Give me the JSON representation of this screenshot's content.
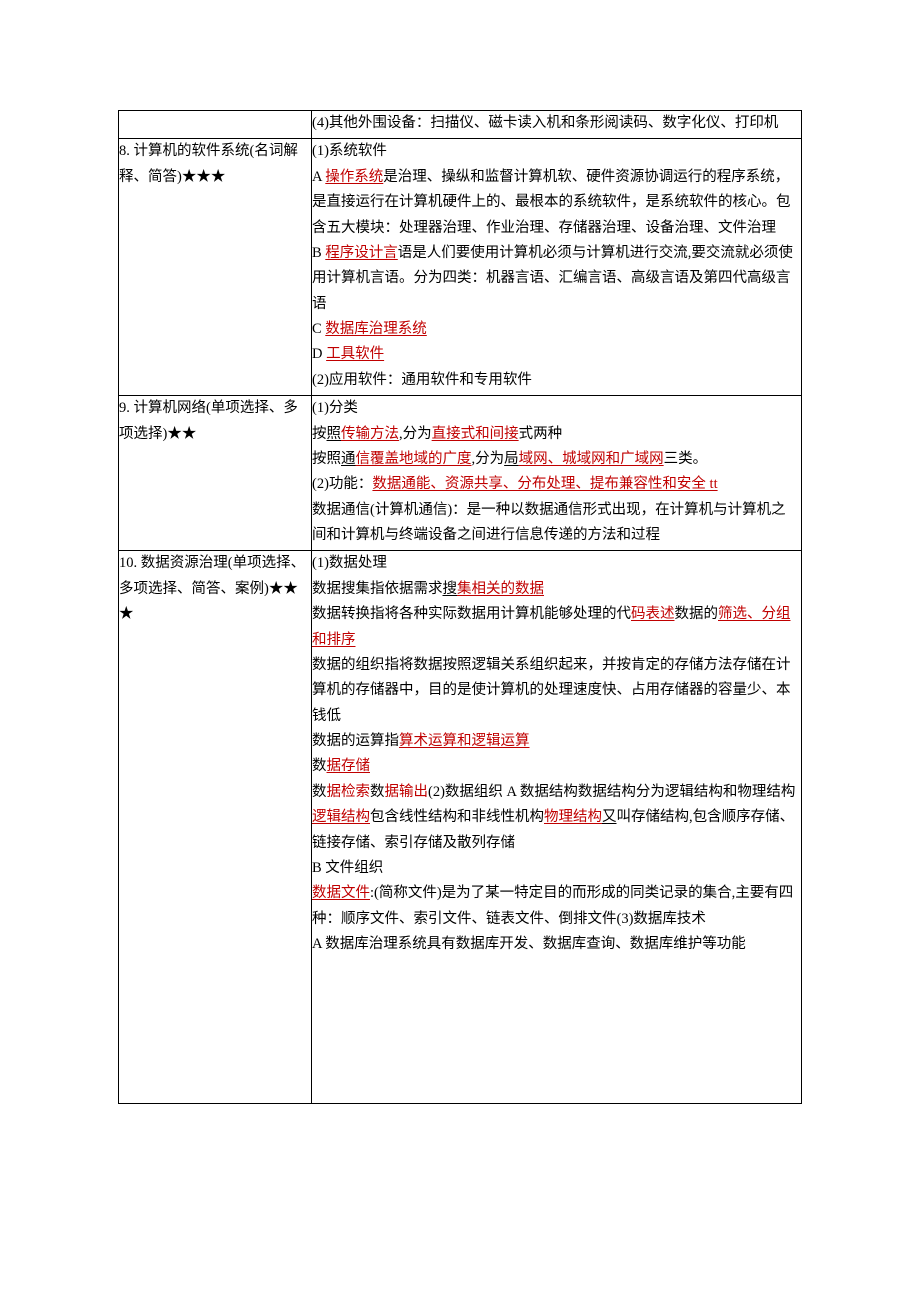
{
  "rows": [
    {
      "left": "",
      "right_parts": [
        {
          "t": "(4)其他外围设备：扫描仪、磁卡读入机和条形阅读码、数字化仪、打印机"
        }
      ]
    },
    {
      "left": "8. 计算机的软件系统(名词解释、简答)★★★",
      "right_parts": [
        {
          "t": "(1)系统软件"
        },
        {
          "br": true
        },
        {
          "t": "A "
        },
        {
          "t": "操作系统",
          "c": "red u"
        },
        {
          "t": "是治理、操纵和监督计算机软、硬件资源协调运行的程序系统，是直接运行在计算机硬件上的、最根本的系统软件，是系统软件的核心。包含五大模块：处理器治理、作业治理、存储器治理、设备治理、文件治理"
        },
        {
          "br": true
        },
        {
          "t": "B "
        },
        {
          "t": "程序设计言",
          "c": "red u"
        },
        {
          "t": "语是人们要使用计算机必须与计算机进行交流,要交流就必须使用计算机言语。分为四类：机器言语、汇编言语、高级言语及第四代高级言语"
        },
        {
          "br": true
        },
        {
          "t": "C "
        },
        {
          "t": "数据库治理系统",
          "c": "red u"
        },
        {
          "br": true
        },
        {
          "t": "D "
        },
        {
          "t": "工具软件",
          "c": "red u"
        },
        {
          "br": true
        },
        {
          "t": "(2)应用软件：通用软件和专用软件"
        }
      ]
    },
    {
      "left": "9. 计算机网络(单项选择、多项选择)★★",
      "right_parts": [
        {
          "t": "(1)分类"
        },
        {
          "br": true
        },
        {
          "t": "按"
        },
        {
          "t": "照",
          "c": "ub"
        },
        {
          "t": "传输方法",
          "c": "red u"
        },
        {
          "t": ",分为"
        },
        {
          "t": "直接式和间接",
          "c": "red u"
        },
        {
          "t": "式两种"
        },
        {
          "br": true
        },
        {
          "t": "按照"
        },
        {
          "t": "通",
          "c": "ub"
        },
        {
          "t": "信覆盖地域的广度",
          "c": "red u"
        },
        {
          "t": ",分为"
        },
        {
          "t": "局",
          "c": "ub"
        },
        {
          "t": "域网、城域网和广域网",
          "c": "red u"
        },
        {
          "t": "三类。"
        },
        {
          "br": true
        },
        {
          "t": "(2)功能："
        },
        {
          "t": "数据通能、资源共享、分布处理、提布兼容性和安全 tt",
          "c": "red u"
        },
        {
          "br": true
        },
        {
          "t": "数据通信(计算机通信)：是一种以数据通信形式出现，在计算机与计算机之间和计算机与终端设备之间进行信息传递的方法和过程"
        },
        {
          "br": true
        },
        {
          "t": " "
        }
      ]
    },
    {
      "left": "10. 数据资源治理(单项选择、多项选择、简答、案例)★★★",
      "right_parts": [
        {
          "t": "(1)数据处理"
        },
        {
          "br": true
        },
        {
          "t": "数据搜集指依据需求"
        },
        {
          "t": "搜",
          "c": "ub"
        },
        {
          "t": "集相关的数据",
          "c": "red u"
        },
        {
          "br": true
        },
        {
          "t": "数据转换指将各种实际数据用计算机能够处理的代"
        },
        {
          "t": "码表述",
          "c": "red u"
        },
        {
          "t": "数据的"
        },
        {
          "t": "筛选、分组和排序",
          "c": "red u"
        },
        {
          "br": true
        },
        {
          "t": "数据的组织指将数据按照逻辑关系组织起来，并按肯定的存储方法存储在计算机的存储器中，目的是使计算机的处理速度快、占用存储器的容量少、本钱低"
        },
        {
          "br": true
        },
        {
          "t": "数据的运算指"
        },
        {
          "t": "算术运算和逻辑运算",
          "c": "red u"
        },
        {
          "br": true
        },
        {
          "t": "数"
        },
        {
          "t": "据存储",
          "c": "red u"
        },
        {
          "br": true
        },
        {
          "t": "数"
        },
        {
          "t": "据检索",
          "c": "red"
        },
        {
          "t": "数"
        },
        {
          "t": "据输出",
          "c": "red"
        },
        {
          "t": "(2)数据组织 A 数据结构数据结构分为逻辑结构和物理结构"
        },
        {
          "t": "逻辑结构",
          "c": "red u"
        },
        {
          "t": "包含线性结构和非线性机构"
        },
        {
          "t": "物理结构",
          "c": "red u"
        },
        {
          "t": "又",
          "c": "ub"
        },
        {
          "t": "叫存储结构,包含顺序存储、链接存储、索引存储及散列存储"
        },
        {
          "br": true
        },
        {
          "t": "B 文件组织"
        },
        {
          "br": true
        },
        {
          "t": "数据文件",
          "c": "red u"
        },
        {
          "t": ":(简称文件)是为了某一特定目的而形成的同类记录的集合,主要有四种：顺序文件、索引文件、链表文件、倒排文件(3)数据库技术"
        },
        {
          "br": true
        },
        {
          "t": "A 数据库治理系统具有数据库开发、数据库查询、数据库维护等功能"
        }
      ],
      "extra_pad": true
    }
  ]
}
